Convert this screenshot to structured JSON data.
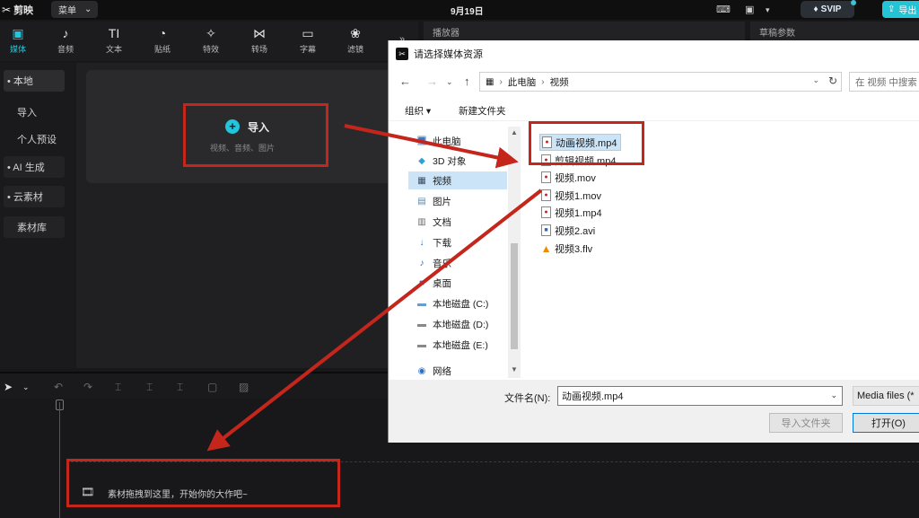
{
  "titlebar": {
    "app_name": "剪映",
    "menu_label": "菜单",
    "menu_chevron": "⌄",
    "date": "9月19日",
    "svip_label": "SVIP",
    "export_label": "导出"
  },
  "toolbar": {
    "items": [
      {
        "label": "媒体",
        "icon": "▣"
      },
      {
        "label": "音频",
        "icon": "♪"
      },
      {
        "label": "文本",
        "icon": "TI"
      },
      {
        "label": "贴纸",
        "icon": "◔"
      },
      {
        "label": "特效",
        "icon": "✧"
      },
      {
        "label": "转场",
        "icon": "⋈"
      },
      {
        "label": "字幕",
        "icon": "▭"
      },
      {
        "label": "滤镜",
        "icon": "❀"
      }
    ],
    "more_icon": "»"
  },
  "sidebar": {
    "local": "• 本地",
    "import": "导入",
    "preset": "个人预设",
    "ai": "• AI 生成",
    "cloud": "• 云素材",
    "library": "素材库"
  },
  "media": {
    "import_label": "导入",
    "import_hint": "视频、音频、图片"
  },
  "right_panels": {
    "player": "播放器",
    "draft": "草稿参数"
  },
  "timeline": {
    "drop_text": "素材拖拽到这里，开始你的大作吧~"
  },
  "dialog": {
    "title": "请选择媒体资源",
    "address": [
      "此电脑",
      "视频"
    ],
    "search_placeholder": "在 视频 中搜索",
    "organize": "组织 ▾",
    "new_folder": "新建文件夹",
    "tree": [
      {
        "label": "此电脑",
        "icon": "🖥"
      },
      {
        "label": "3D 对象",
        "icon": "◆"
      },
      {
        "label": "视频",
        "icon": "▦"
      },
      {
        "label": "图片",
        "icon": "▤"
      },
      {
        "label": "文档",
        "icon": "▥"
      },
      {
        "label": "下载",
        "icon": "↓"
      },
      {
        "label": "音乐",
        "icon": "♪"
      },
      {
        "label": "桌面",
        "icon": "■"
      },
      {
        "label": "本地磁盘 (C:)",
        "icon": "▬"
      },
      {
        "label": "本地磁盘 (D:)",
        "icon": "▬"
      },
      {
        "label": "本地磁盘 (E:)",
        "icon": "▬"
      },
      {
        "label": "网络",
        "icon": "◉"
      }
    ],
    "files": [
      "动画视频.mp4",
      "剪辑视频.mp4",
      "视频.mov",
      "视频1.mov",
      "视频1.mp4",
      "视频2.avi",
      "视频3.flv"
    ],
    "filename_label": "文件名(N):",
    "filename_value": "动画视频.mp4",
    "filetype": "Media files (*",
    "import_folder_btn": "导入文件夹",
    "open_btn": "打开(O)"
  },
  "colors": {
    "accent": "#21c5dc",
    "highlight_red": "#c4261c",
    "dialog_selection": "#cce4f7"
  }
}
